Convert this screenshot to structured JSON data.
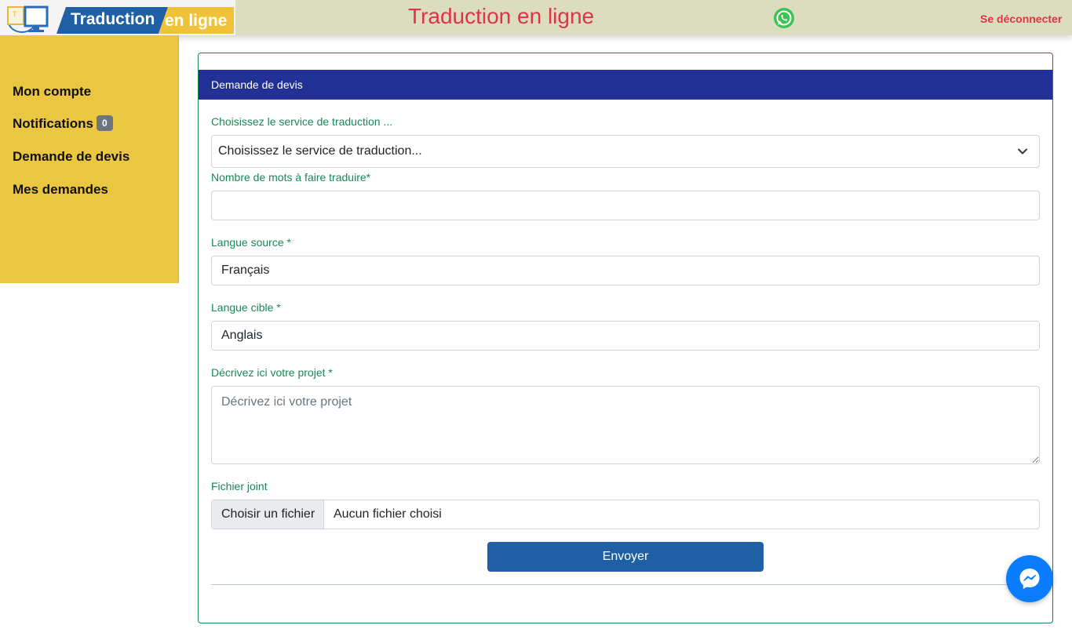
{
  "header": {
    "logo_text_1": "Traduction",
    "logo_text_2": "en ligne",
    "site_title": "Traduction en ligne",
    "logout_label": "Se déconnecter",
    "whatsapp_icon": "whatsapp-icon"
  },
  "sidebar": {
    "items": [
      {
        "label": "Mon compte"
      },
      {
        "label": "Notifications",
        "badge": "0"
      },
      {
        "label": "Demande de devis"
      },
      {
        "label": "Mes demandes"
      }
    ]
  },
  "form": {
    "title": "Demande de devis",
    "service_label": "Choisissez le service de traduction ...",
    "service_value": "Choisissez le service de traduction...",
    "words_label": "Nombre de mots à faire traduire*",
    "words_value": "",
    "source_label": "Langue source *",
    "source_value": "Français",
    "target_label": "Langue cible *",
    "target_value": "Anglais",
    "desc_label": "Décrivez ici votre projet *",
    "desc_placeholder": "Décrivez ici votre projet",
    "file_label": "Fichier joint",
    "file_button": "Choisir un fichier",
    "file_status": "Aucun fichier choisi",
    "submit_label": "Envoyer"
  },
  "colors": {
    "header_bg": "#dcdcbe",
    "sidebar_bg": "#eac641",
    "card_header_bg": "#223196",
    "label_green": "#198754",
    "title_red": "#dc3545",
    "button_blue": "#1e5fa6",
    "messenger_blue": "#0a7cff"
  },
  "chat_widget": {
    "icon": "messenger-icon"
  }
}
